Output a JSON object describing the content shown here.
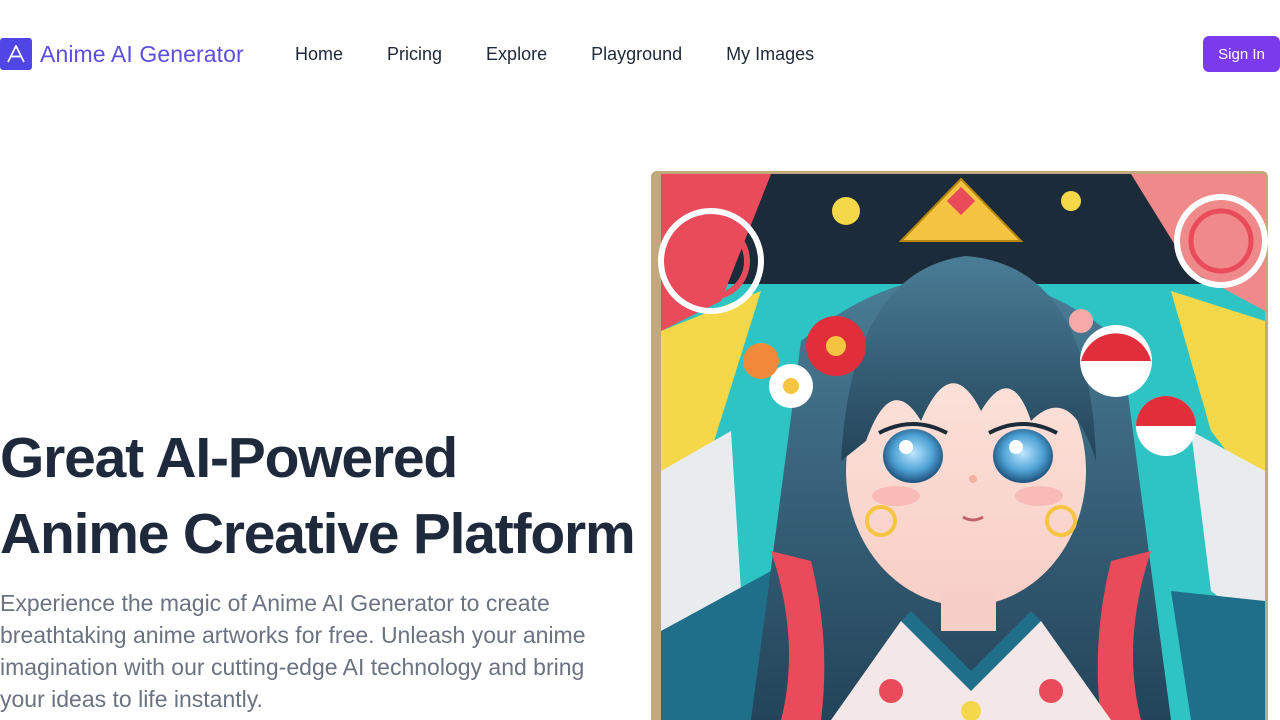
{
  "header": {
    "brand_name": "Anime AI Generator",
    "brand_logo_icon": "letter-a-logo-icon",
    "nav": [
      {
        "label": "Home"
      },
      {
        "label": "Pricing"
      },
      {
        "label": "Explore"
      },
      {
        "label": "Playground"
      },
      {
        "label": "My Images"
      }
    ],
    "sign_in_label": "Sign In"
  },
  "hero": {
    "title_line1": "Great AI-Powered",
    "title_line2": "Anime Creative Platform",
    "description": "Experience the magic of Anime AI Generator to create breathtaking anime artworks for free. Unleash your anime imagination with our cutting-edge AI technology and bring your ideas to life instantly.",
    "image_subject": "anime-girl-illustration"
  },
  "colors": {
    "brand": "#5b4ee0",
    "logo_bg": "#4f46e5",
    "sign_in_bg": "#7c3aed",
    "title": "#1e293b",
    "description": "#6b7280"
  }
}
